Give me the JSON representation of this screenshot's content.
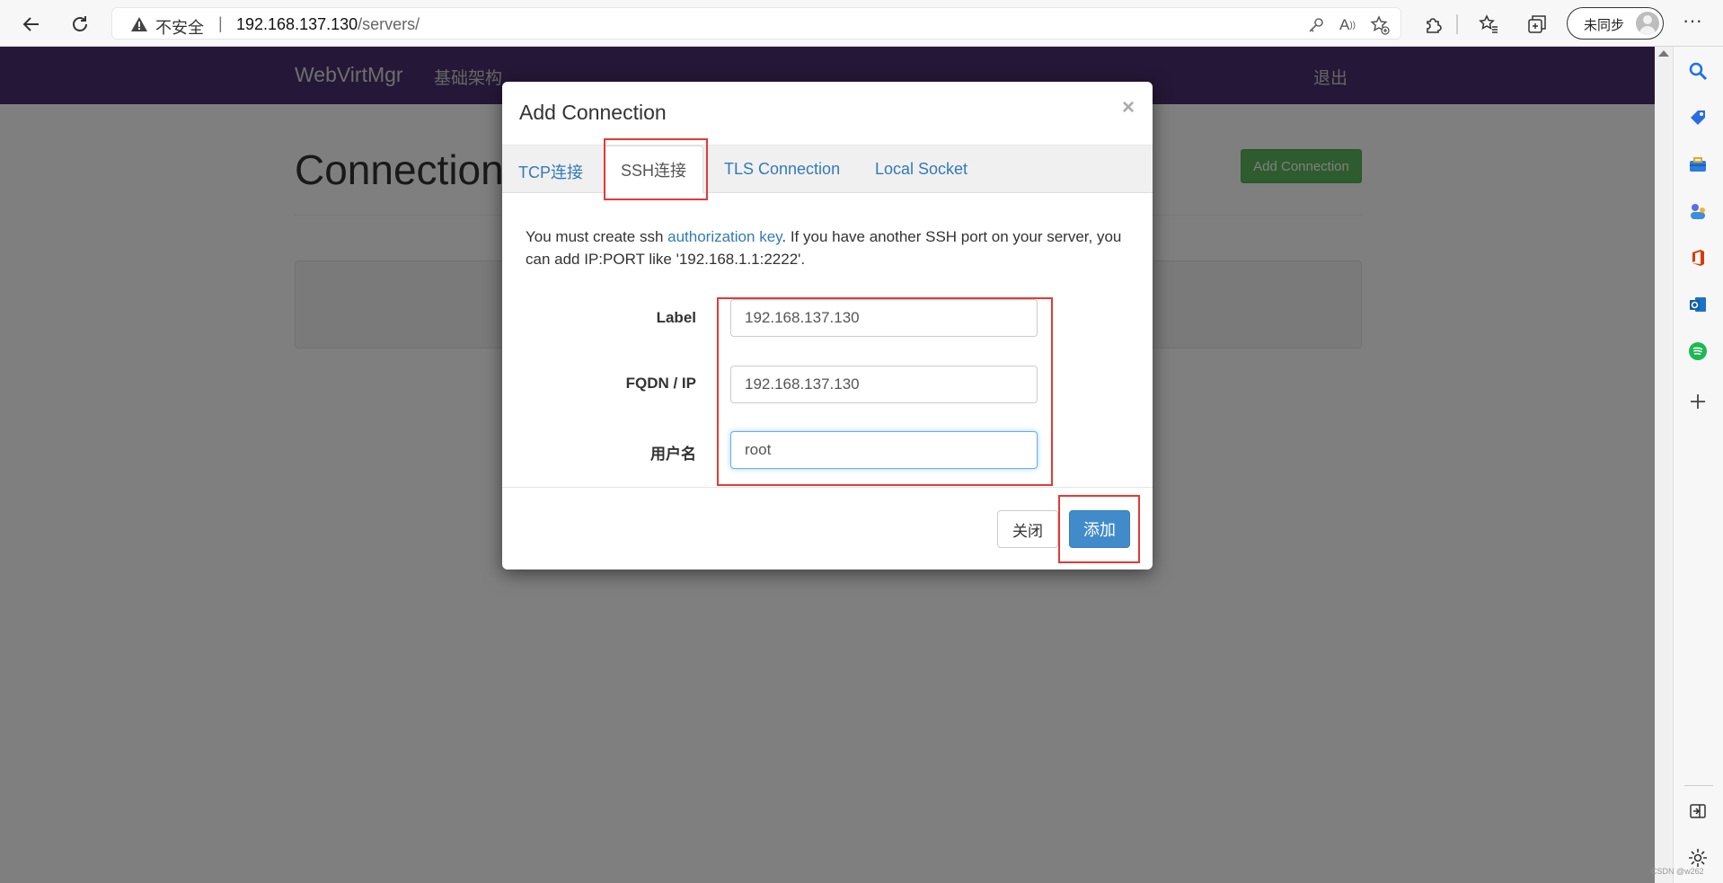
{
  "browser": {
    "insecure_label": "不安全",
    "separator": "|",
    "url_host": "192.168.137.130",
    "url_path": "/servers/",
    "profile_label": "未同步",
    "more": "···"
  },
  "page": {
    "brand": "WebVirtMgr",
    "nav_infrastructure": "基础架构",
    "logout": "退出",
    "heading": "Connections",
    "add_connection_button": "Add Connection"
  },
  "modal": {
    "title": "Add Connection",
    "close_symbol": "×",
    "tabs": [
      {
        "label": "TCP连接"
      },
      {
        "label": "SSH连接"
      },
      {
        "label": "TLS Connection"
      },
      {
        "label": "Local Socket"
      }
    ],
    "active_tab": "SSH连接",
    "intro_before": "You must create ssh ",
    "intro_link": "authorization key",
    "intro_after": ". If you have another SSH port on your server, you can add IP:PORT like '192.168.1.1:2222'.",
    "fields": {
      "label": {
        "name": "Label",
        "value": "192.168.137.130"
      },
      "fqdn": {
        "name": "FQDN / IP",
        "value": "192.168.137.130"
      },
      "username": {
        "name": "用户名",
        "value": "root"
      }
    },
    "close_button": "关闭",
    "add_button": "添加"
  },
  "watermark": "CSDN @w262",
  "colors": {
    "navbar": "#4a2f6e",
    "primary": "#428bca",
    "success": "#5cb85c",
    "highlight": "#e53935"
  }
}
